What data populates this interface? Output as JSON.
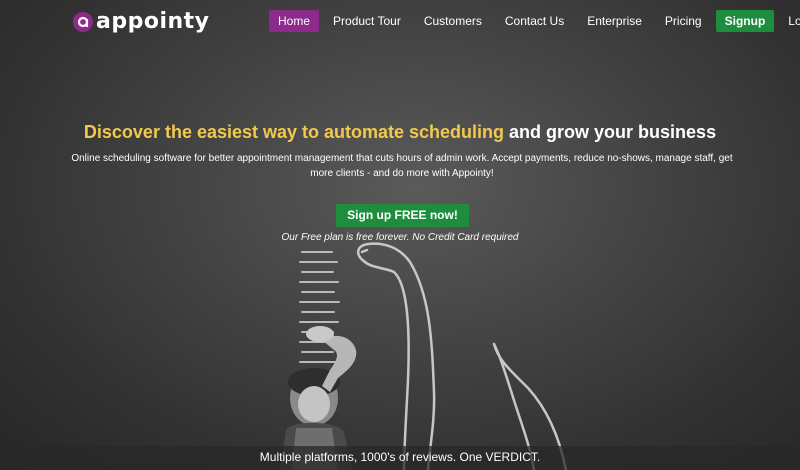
{
  "brand": {
    "name": "appointy",
    "accent": "#8e2a8c",
    "cta_color": "#1e8e3e",
    "headline_highlight": "#f2c94c"
  },
  "nav": {
    "items": [
      {
        "label": "Home",
        "active": true
      },
      {
        "label": "Product Tour"
      },
      {
        "label": "Customers"
      },
      {
        "label": "Contact Us"
      },
      {
        "label": "Enterprise"
      },
      {
        "label": "Pricing"
      },
      {
        "label": "Signup",
        "style": "button"
      },
      {
        "label": "Login"
      }
    ]
  },
  "hero": {
    "headline_highlight": "Discover the easiest way to automate scheduling",
    "headline_rest": " and grow your business",
    "subtext": "Online scheduling software for better appointment management that cuts hours of admin work. Accept payments, reduce no-shows, manage staff, get more clients - and do more with Appointy!",
    "cta_label": "Sign up FREE now!",
    "cta_note": "Our Free plan is free forever. No Credit Card required"
  },
  "footer_band": {
    "text": "Multiple platforms, 1000's of reviews. One VERDICT."
  }
}
